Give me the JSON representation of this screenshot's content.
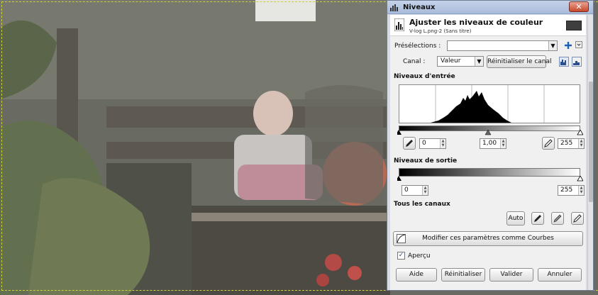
{
  "dialog": {
    "window_title": "Niveaux",
    "close_label": "✕",
    "header_title": "Ajuster les niveaux de couleur",
    "header_subtitle": "V-log L.png-2 (Sans titre)"
  },
  "presets": {
    "label": "Présélections :",
    "value": ""
  },
  "channel": {
    "label": "Canal :",
    "value": "Valeur",
    "reset_label": "Réinitialiser le canal"
  },
  "input_levels": {
    "title": "Niveaux d'entrée",
    "low": "0",
    "gamma": "1,00",
    "high": "255"
  },
  "output_levels": {
    "title": "Niveaux de sortie",
    "low": "0",
    "high": "255"
  },
  "all_channels": {
    "title": "Tous les canaux",
    "auto_label": "Auto"
  },
  "curves_button": "Modifier ces paramètres comme Courbes",
  "preview": {
    "label": "Aperçu",
    "checked": true
  },
  "footer": {
    "help": "Aide",
    "reset": "Réinitialiser",
    "ok": "Valider",
    "cancel": "Annuler"
  },
  "colors": {
    "accent": "#a9bbdb",
    "close": "#c9482c"
  }
}
